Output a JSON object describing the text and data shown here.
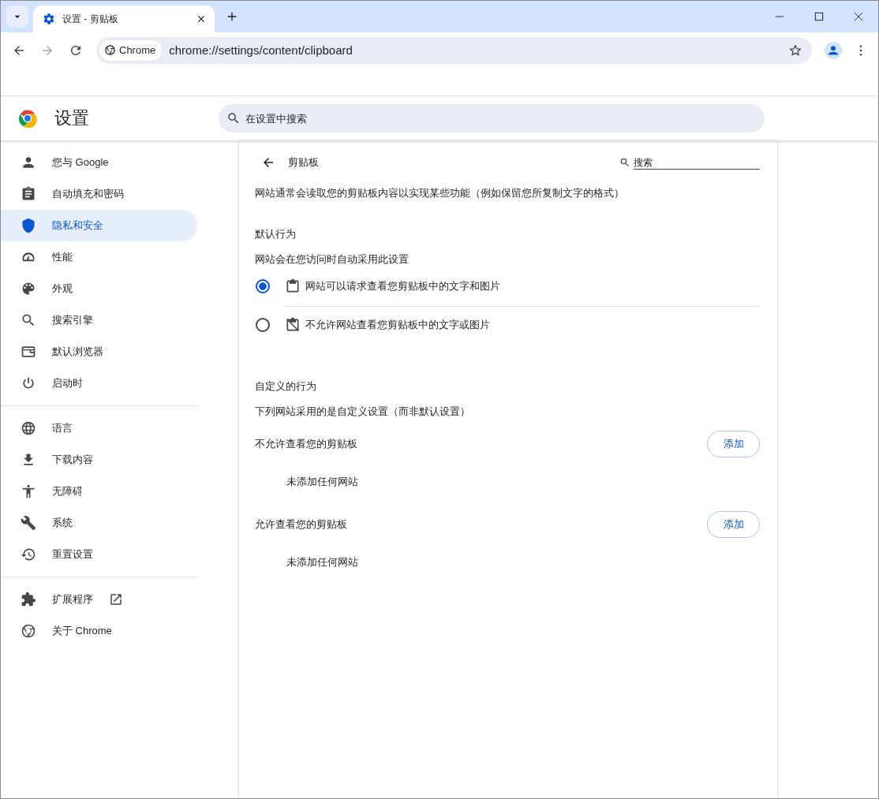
{
  "tabs": [
    {
      "title": "设置 - 剪贴板",
      "selected": true
    }
  ],
  "toolbar": {
    "chip": "Chrome",
    "url": "chrome://settings/content/clipboard"
  },
  "header": {
    "title": "设置",
    "search": {
      "placeholder": "在设置中搜索"
    }
  },
  "sidebar": {
    "groups": [
      [
        {
          "label": "您与 Google",
          "selected": false,
          "external": false
        },
        {
          "label": "自动填充和密码",
          "selected": false,
          "external": false
        },
        {
          "label": "隐私和安全",
          "selected": true,
          "external": false
        },
        {
          "label": "性能",
          "selected": false,
          "external": false
        },
        {
          "label": "外观",
          "selected": false,
          "external": false
        },
        {
          "label": "搜索引擎",
          "selected": false,
          "external": false
        },
        {
          "label": "默认浏览器",
          "selected": false,
          "external": false
        },
        {
          "label": "启动时",
          "selected": false,
          "external": false
        }
      ],
      [
        {
          "label": "语言",
          "selected": false,
          "external": false
        },
        {
          "label": "下载内容",
          "selected": false,
          "external": false
        },
        {
          "label": "无障碍",
          "selected": false,
          "external": false
        },
        {
          "label": "系统",
          "selected": false,
          "external": false
        },
        {
          "label": "重置设置",
          "selected": false,
          "external": false
        }
      ],
      [
        {
          "label": "扩展程序",
          "selected": false,
          "external": true
        },
        {
          "label": "关于 Chrome",
          "selected": false,
          "external": false
        }
      ]
    ]
  },
  "page": {
    "title": "剪贴板",
    "search": {
      "placeholder": "搜索"
    },
    "description": "网站通常会读取您的剪贴板内容以实现某些功能（例如保留您所复制文字的格式）",
    "default_heading": "默认行为",
    "default_subtitle": "网站会在您访问时自动采用此设置",
    "options": [
      {
        "label": "网站可以请求查看您剪贴板中的文字和图片",
        "selected": true
      },
      {
        "label": "不允许网站查看您剪贴板中的文字或图片",
        "selected": false
      }
    ],
    "custom_heading": "自定义的行为",
    "custom_subtitle": "下列网站采用的是自定义设置（而非默认设置）",
    "lists": [
      {
        "title": "不允许查看您的剪贴板",
        "button": "添加",
        "empty": "未添加任何网站"
      },
      {
        "title": "允许查看您的剪贴板",
        "button": "添加",
        "empty": "未添加任何网站"
      }
    ]
  }
}
